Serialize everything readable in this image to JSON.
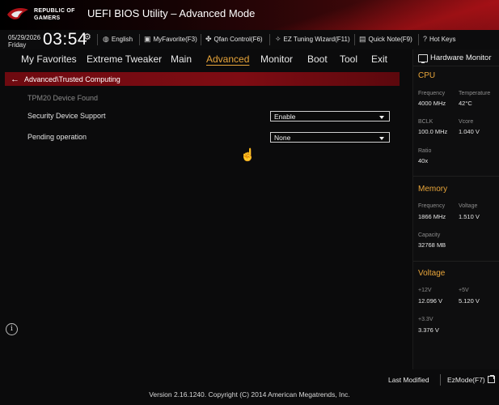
{
  "header": {
    "logo_line1": "REPUBLIC OF",
    "logo_line2": "GAMERS",
    "title": "UEFI BIOS Utility – Advanced Mode"
  },
  "infobar": {
    "date": "05/29/2026",
    "day": "Friday",
    "time": "03:54",
    "tools": [
      {
        "icon": "globe-icon",
        "label": "English"
      },
      {
        "icon": "myfavorite-icon",
        "label": "MyFavorite(F3)"
      },
      {
        "icon": "fan-icon",
        "label": "Qfan Control(F6)"
      },
      {
        "icon": "tuning-bulb-icon",
        "label": "EZ Tuning Wizard(F11)"
      },
      {
        "icon": "note-icon",
        "label": "Quick Note(F9)"
      },
      {
        "icon": "help-icon",
        "label": "Hot Keys"
      }
    ]
  },
  "menu": {
    "items": [
      "My Favorites",
      "Extreme Tweaker",
      "Main",
      "Advanced",
      "Monitor",
      "Boot",
      "Tool",
      "Exit"
    ],
    "active": "Advanced"
  },
  "breadcrumb": {
    "text": "Advanced\\Trusted Computing"
  },
  "main": {
    "status_text": "TPM20 Device Found",
    "rows": [
      {
        "label": "Security Device Support",
        "value": "Enable"
      },
      {
        "label": "Pending operation",
        "value": "None"
      }
    ]
  },
  "hardware_monitor": {
    "title": "Hardware Monitor",
    "cpu": {
      "section": "CPU",
      "frequency_label": "Frequency",
      "frequency": "4000 MHz",
      "temperature_label": "Temperature",
      "temperature": "42°C",
      "bclk_label": "BCLK",
      "bclk": "100.0 MHz",
      "vcore_label": "Vcore",
      "vcore": "1.040 V",
      "ratio_label": "Ratio",
      "ratio": "40x"
    },
    "memory": {
      "section": "Memory",
      "frequency_label": "Frequency",
      "frequency": "1866 MHz",
      "voltage_label": "Voltage",
      "voltage": "1.510 V",
      "capacity_label": "Capacity",
      "capacity": "32768 MB"
    },
    "voltage": {
      "section": "Voltage",
      "v12_label": "+12V",
      "v12": "12.096 V",
      "v5_label": "+5V",
      "v5": "5.120 V",
      "v33_label": "+3.3V",
      "v33": "3.376 V"
    }
  },
  "footer": {
    "last_modified": "Last Modified",
    "ezmode": "EzMode(F7)",
    "version": "Version 2.16.1240. Copyright (C) 2014 American Megatrends, Inc."
  },
  "colors": {
    "accent": "#e8a53a",
    "breadcrumb_bg": "#7a0c12",
    "background": "#0b0b0c"
  }
}
